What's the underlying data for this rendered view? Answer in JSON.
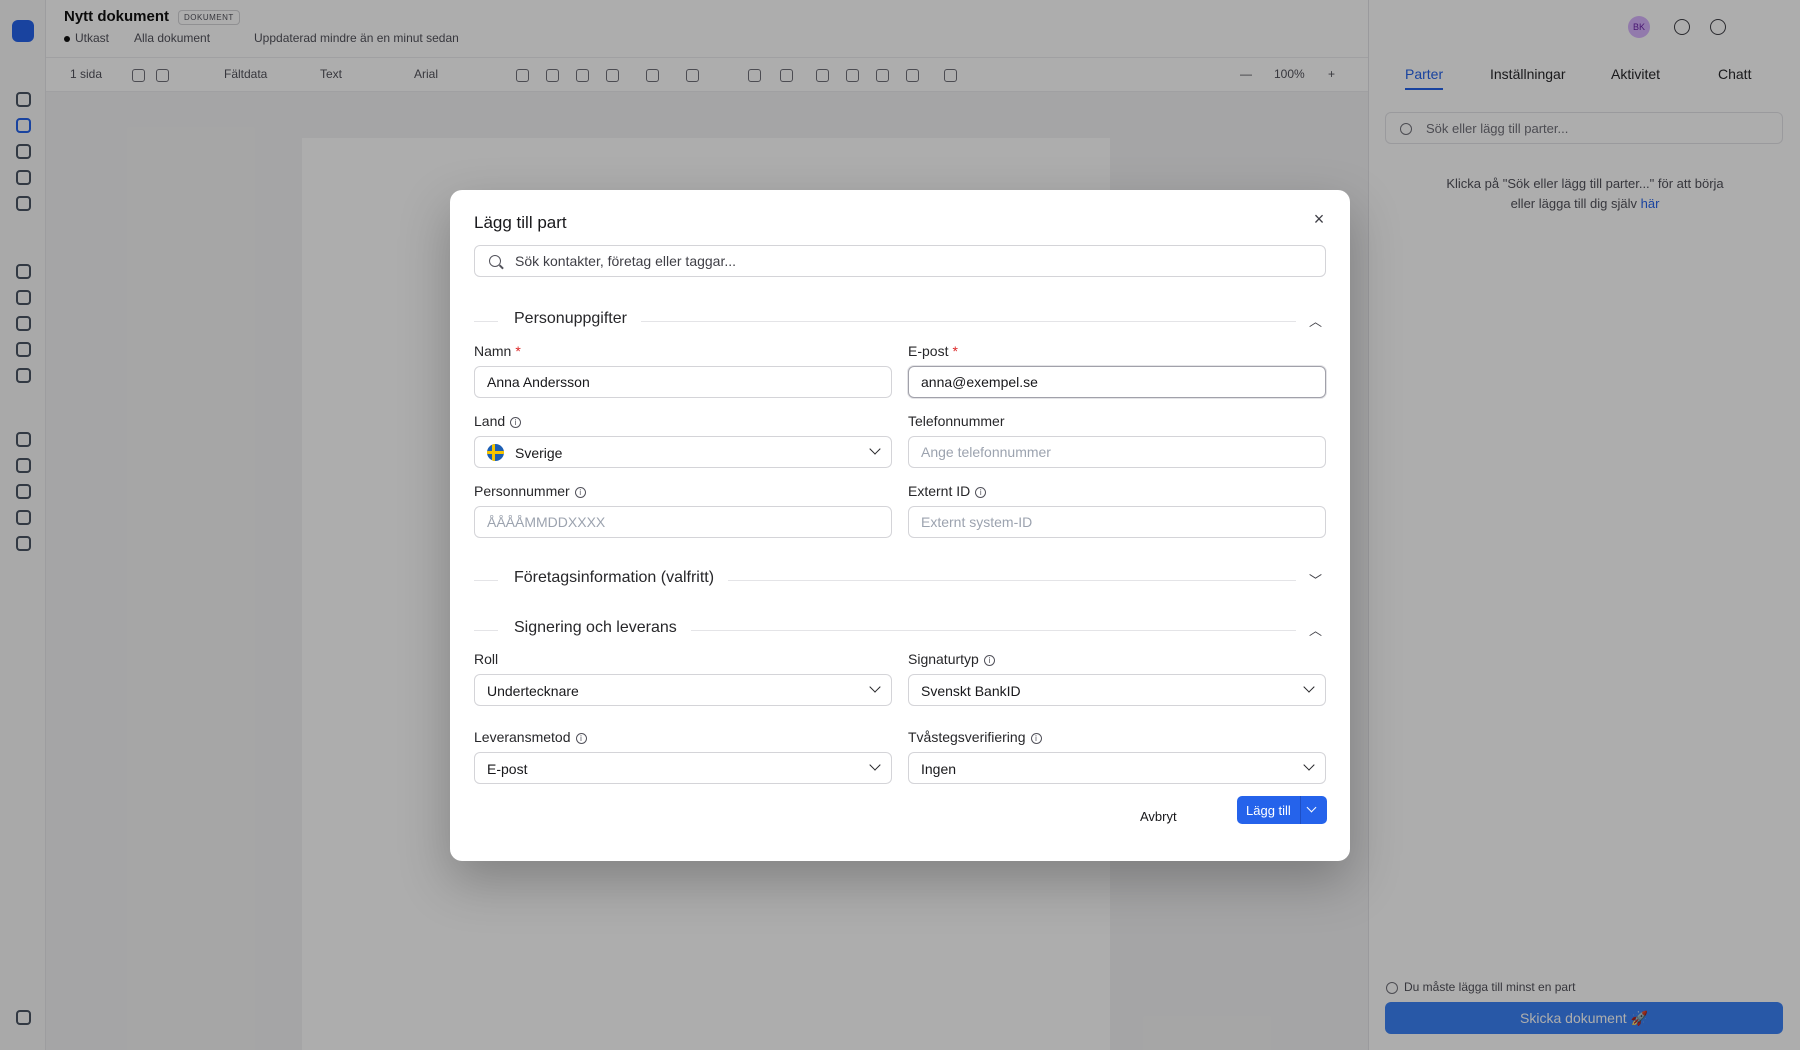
{
  "background": {
    "doc_title": "Nytt dokument",
    "doc_badge": "DOKUMENT",
    "status": "Utkast",
    "all_docs": "Alla dokument",
    "updated": "Uppdaterad mindre än en minut sedan",
    "toolbar": {
      "pages": "1 sida",
      "signature": "Fältdata",
      "text": "Text",
      "font": "Arial",
      "zoom": "100%"
    },
    "user_initials": "BK",
    "right_tabs": [
      "Parter",
      "Inställningar",
      "Aktivitet",
      "Chatt"
    ],
    "right_search_placeholder": "Sök eller lägg till parter...",
    "right_help": "Klicka på \"Sök eller lägg till parter...\" för att börja eller lägga till dig själv",
    "right_help_link": "här",
    "right_warning": "Du måste lägga till minst en part",
    "send_button": "Skicka dokument 🚀"
  },
  "modal": {
    "title": "Lägg till part",
    "close_glyph": "×",
    "search_placeholder": "Sök kontakter, företag eller taggar...",
    "sections": {
      "personal": "Personuppgifter",
      "company": "Företagsinformation (valfritt)",
      "signing": "Signering och leverans"
    },
    "fields": {
      "name": {
        "label": "Namn",
        "value": "Anna Andersson"
      },
      "email": {
        "label": "E-post",
        "value": "anna@exempel.se"
      },
      "country": {
        "label": "Land",
        "value": "Sverige"
      },
      "phone": {
        "label": "Telefonnummer",
        "placeholder": "Ange telefonnummer"
      },
      "personal_number": {
        "label": "Personnummer",
        "placeholder": "ÅÅÅÅMMDDXXXX"
      },
      "external_id": {
        "label": "Externt ID",
        "placeholder": "Externt system-ID"
      },
      "role": {
        "label": "Roll",
        "value": "Undertecknare"
      },
      "signature_type": {
        "label": "Signaturtyp",
        "value": "Svenskt BankID"
      },
      "delivery_method": {
        "label": "Leveransmetod",
        "value": "E-post"
      },
      "two_step": {
        "label": "Tvåstegsverifiering",
        "value": "Ingen"
      }
    },
    "required_mark": "*",
    "info_glyph": "i",
    "cancel_label": "Avbryt",
    "add_label": "Lägg till"
  },
  "colors": {
    "accent": "#2563eb",
    "required": "#dc2626",
    "overlay": "rgba(0,0,0,0.32)"
  }
}
